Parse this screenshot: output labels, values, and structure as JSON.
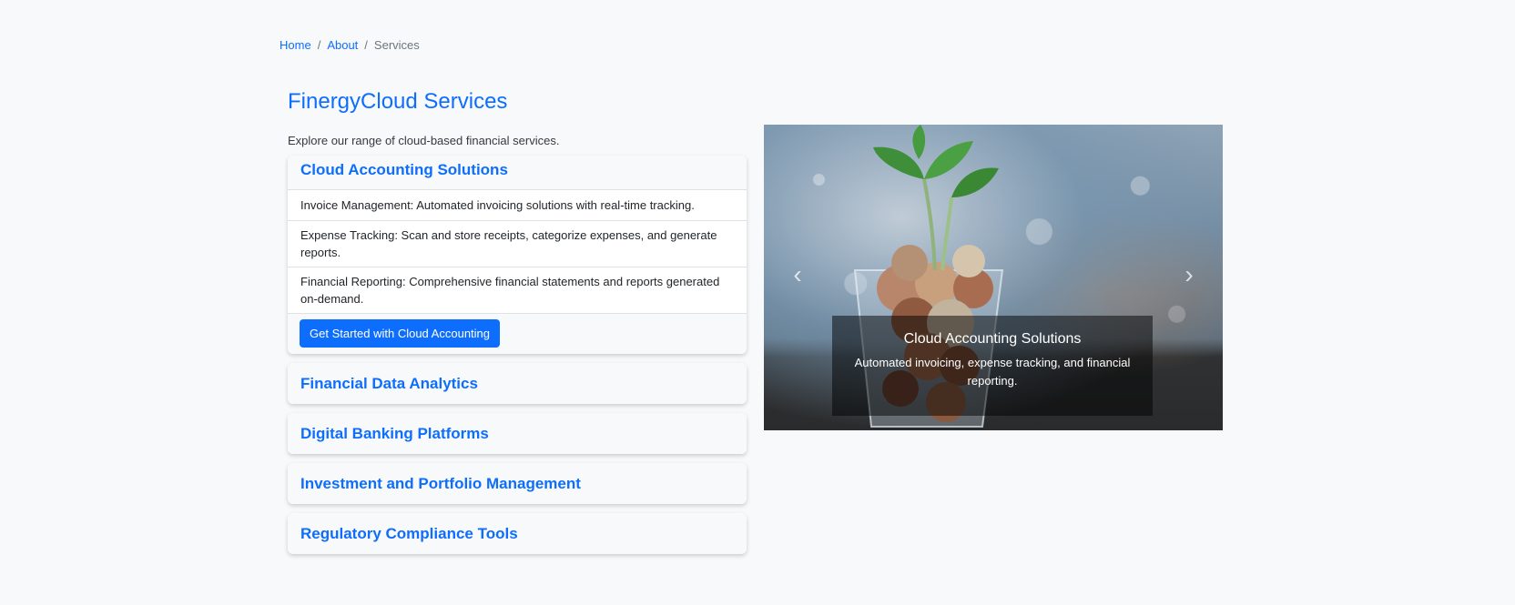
{
  "breadcrumb": {
    "home": "Home",
    "about": "About",
    "current": "Services",
    "separator": "/"
  },
  "page": {
    "title": "FinergyCloud Services",
    "intro": "Explore our range of cloud-based financial services."
  },
  "accordion": {
    "open_section": {
      "title": "Cloud Accounting Solutions",
      "items": [
        "Invoice Management: Automated invoicing solutions with real-time tracking.",
        "Expense Tracking: Scan and store receipts, categorize expenses, and generate reports.",
        "Financial Reporting: Comprehensive financial statements and reports generated on-demand."
      ],
      "button_label": "Get Started with Cloud Accounting"
    },
    "closed_sections": [
      "Financial Data Analytics",
      "Digital Banking Platforms",
      "Investment and Portfolio Management",
      "Regulatory Compliance Tools"
    ]
  },
  "carousel": {
    "caption_title": "Cloud Accounting Solutions",
    "caption_text": "Automated invoicing, expense tracking, and financial reporting.",
    "prev_icon": "chevron-left-icon",
    "next_icon": "chevron-right-icon"
  },
  "colors": {
    "accent": "#0d6efd",
    "background": "#f8f9fa"
  }
}
